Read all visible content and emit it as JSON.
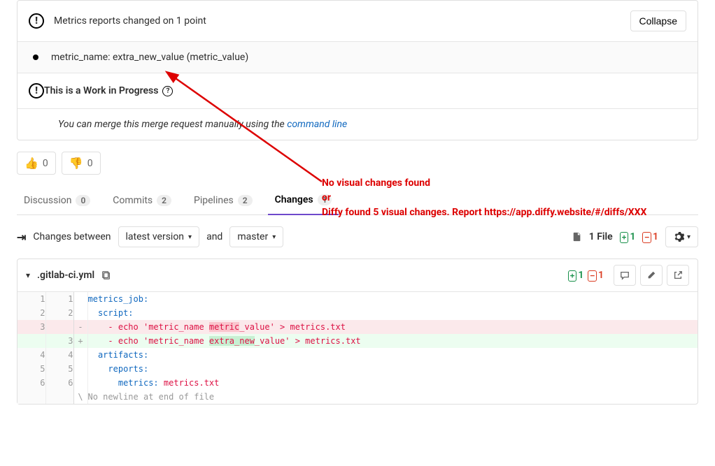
{
  "metrics_panel": {
    "title": "Metrics reports changed on 1 point",
    "collapse_label": "Collapse",
    "detail": "metric_name: extra_new_value (metric_value)"
  },
  "wip_panel": {
    "title": "This is a Work in Progress",
    "merge_prefix": "You can merge this merge request manually using the ",
    "merge_link": "command line"
  },
  "reactions": {
    "up": "0",
    "down": "0"
  },
  "tabs": {
    "discussion": {
      "label": "Discussion",
      "count": "0"
    },
    "commits": {
      "label": "Commits",
      "count": "2"
    },
    "pipelines": {
      "label": "Pipelines",
      "count": "2"
    },
    "changes": {
      "label": "Changes",
      "count": "1"
    }
  },
  "toolbar": {
    "changes_between": "Changes between",
    "latest": "latest version",
    "and": "and",
    "master": "master",
    "files": "1 File",
    "add": "1",
    "del": "1"
  },
  "file": {
    "name": ".gitlab-ci.yml",
    "add": "1",
    "del": "1"
  },
  "diff": {
    "rows": [
      {
        "o": "1",
        "n": "1",
        "t": " ",
        "code": "metrics_job:",
        "indent": 0
      },
      {
        "o": "2",
        "n": "2",
        "t": " ",
        "code": "script:",
        "indent": 1
      },
      {
        "o": "3",
        "n": "",
        "t": "-",
        "code_before": "- echo 'metric_name ",
        "hl": "metric",
        "code_after": "_value' > metrics.txt",
        "indent": 2,
        "cls": "del"
      },
      {
        "o": "",
        "n": "3",
        "t": "+",
        "code_before": "- echo 'metric_name ",
        "hl": "extra_new",
        "code_after": "_value' > metrics.txt",
        "indent": 2,
        "cls": "add"
      },
      {
        "o": "4",
        "n": "4",
        "t": " ",
        "code": "artifacts:",
        "indent": 1
      },
      {
        "o": "5",
        "n": "5",
        "t": " ",
        "code": "reports:",
        "indent": 2
      },
      {
        "o": "6",
        "n": "6",
        "t": " ",
        "code": "metrics: metrics.txt",
        "indent": 3
      }
    ],
    "footer": "No newline at end of file"
  },
  "annotation": {
    "line1": "No visual changes found",
    "line2": "or",
    "line3": "Diffy found 5 visual changes. Report https://app.diffy.website/#/diffs/XXX"
  }
}
